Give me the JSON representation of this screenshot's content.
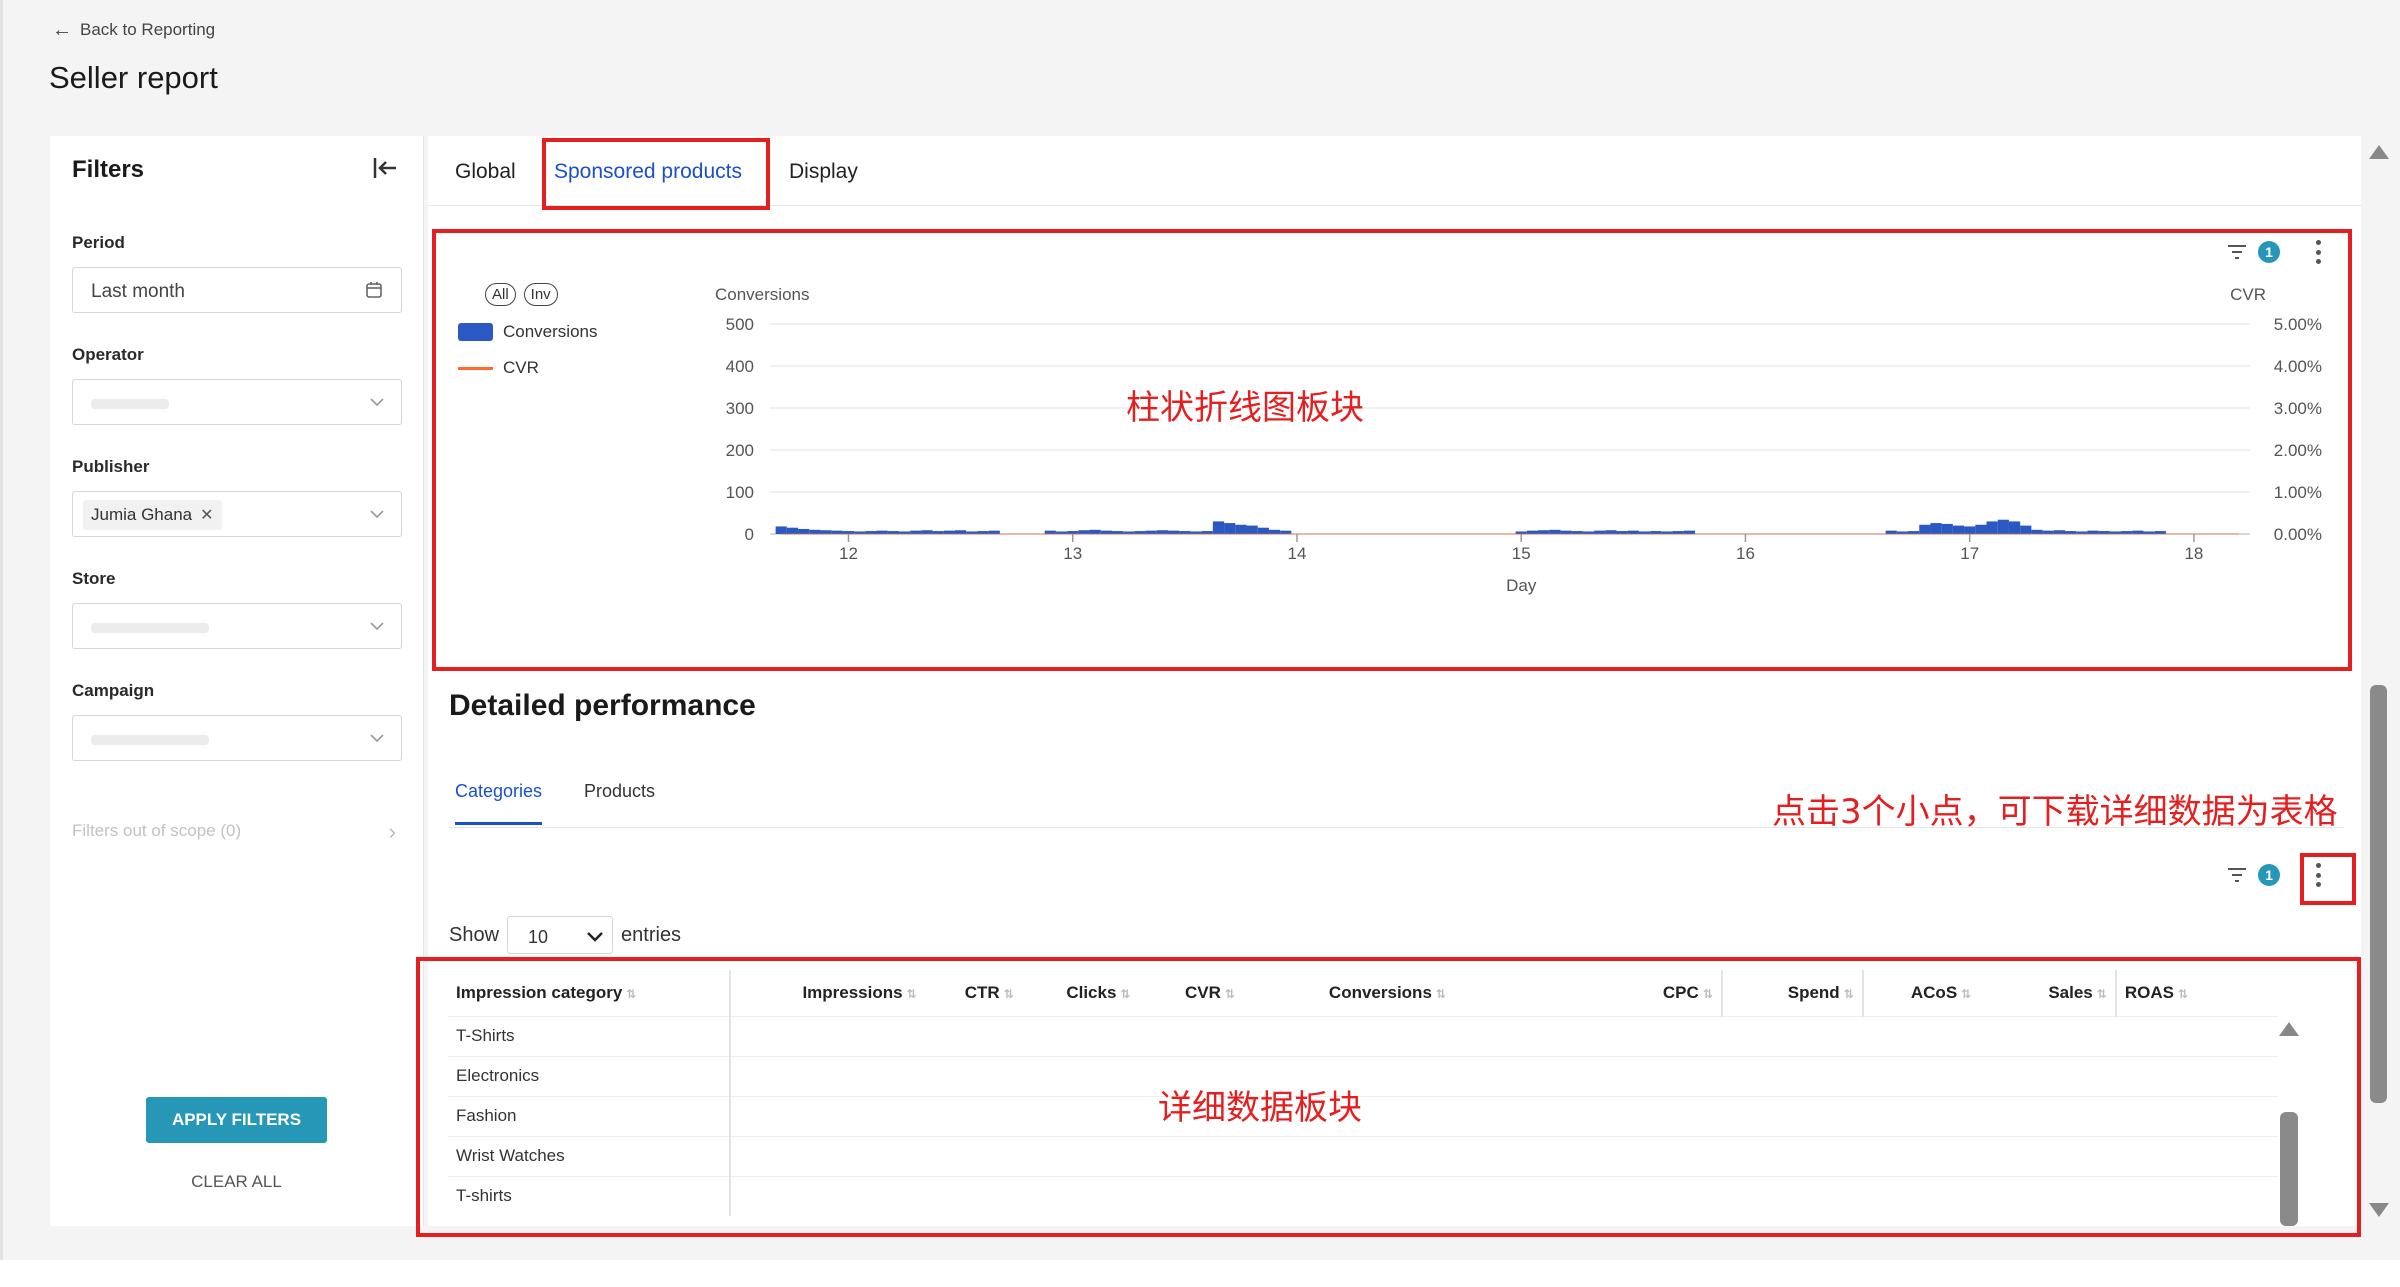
{
  "header": {
    "back_label": "Back to Reporting",
    "page_title": "Seller report"
  },
  "filters": {
    "title": "Filters",
    "period": {
      "label": "Period",
      "value": "Last month"
    },
    "operator": {
      "label": "Operator"
    },
    "publisher": {
      "label": "Publisher",
      "chip": "Jumia Ghana"
    },
    "store": {
      "label": "Store"
    },
    "campaign": {
      "label": "Campaign"
    },
    "out_of_scope": "Filters out of scope (0)",
    "apply_label": "APPLY FILTERS",
    "clear_label": "CLEAR ALL"
  },
  "main_tabs": [
    {
      "label": "Global"
    },
    {
      "label": "Sponsored products"
    },
    {
      "label": "Display"
    }
  ],
  "toolbar": {
    "filter_count": "1"
  },
  "chart_legend": {
    "pill_all": "All",
    "pill_inv": "Inv"
  },
  "chart_data": {
    "type": "bar",
    "title": "",
    "xlabel": "Day",
    "ylabel": "Conversions",
    "y2label": "CVR",
    "ylim": [
      0,
      500
    ],
    "y2lim": [
      0,
      5
    ],
    "yticks": [
      "500",
      "400",
      "300",
      "200",
      "100",
      "0"
    ],
    "y2ticks": [
      "5.00%",
      "4.00%",
      "3.00%",
      "2.00%",
      "1.00%",
      "0.00%"
    ],
    "xticks": [
      12,
      13,
      14,
      15,
      16,
      17,
      18
    ],
    "xlim": [
      11.65,
      18.25
    ],
    "legend": "left",
    "grid": true,
    "series": [
      {
        "name": "Conversions",
        "kind": "bar",
        "color": "#2b59c3",
        "x": [
          11.7,
          11.75,
          11.8,
          11.85,
          11.9,
          11.95,
          12.0,
          12.05,
          12.1,
          12.15,
          12.2,
          12.25,
          12.3,
          12.35,
          12.4,
          12.45,
          12.5,
          12.55,
          12.6,
          12.65,
          12.9,
          12.95,
          13.0,
          13.05,
          13.1,
          13.15,
          13.2,
          13.25,
          13.3,
          13.35,
          13.4,
          13.45,
          13.5,
          13.55,
          13.6,
          13.65,
          13.7,
          13.75,
          13.8,
          13.85,
          13.9,
          13.95,
          15.0,
          15.05,
          15.1,
          15.15,
          15.2,
          15.25,
          15.3,
          15.35,
          15.4,
          15.45,
          15.5,
          15.55,
          15.6,
          15.65,
          15.7,
          15.75,
          16.65,
          16.7,
          16.75,
          16.8,
          16.85,
          16.9,
          16.95,
          17.0,
          17.05,
          17.1,
          17.15,
          17.2,
          17.25,
          17.3,
          17.35,
          17.4,
          17.45,
          17.5,
          17.55,
          17.6,
          17.65,
          17.7,
          17.75,
          17.8,
          17.85
        ],
        "values": [
          18,
          15,
          12,
          10,
          9,
          8,
          7,
          6,
          7,
          8,
          7,
          6,
          8,
          9,
          7,
          8,
          9,
          6,
          7,
          8,
          8,
          6,
          7,
          9,
          10,
          8,
          7,
          6,
          7,
          8,
          9,
          8,
          7,
          6,
          7,
          30,
          26,
          22,
          20,
          15,
          10,
          8,
          6,
          8,
          9,
          10,
          8,
          7,
          6,
          8,
          9,
          7,
          8,
          6,
          7,
          6,
          7,
          8,
          8,
          6,
          7,
          22,
          26,
          24,
          20,
          18,
          22,
          30,
          34,
          30,
          20,
          10,
          8,
          9,
          7,
          6,
          8,
          7,
          6,
          7,
          8,
          6,
          7
        ]
      },
      {
        "name": "CVR",
        "kind": "line",
        "color": "#ff6b2c",
        "axis": "right",
        "x": [
          11.7,
          18.2
        ],
        "values": [
          0,
          0
        ]
      }
    ]
  },
  "detail": {
    "title": "Detailed performance",
    "tabs": [
      {
        "label": "Categories"
      },
      {
        "label": "Products"
      }
    ],
    "show_label": "Show",
    "show_value": "10",
    "entries_label": "entries",
    "columns": [
      "Impression category",
      "Impressions",
      "CTR",
      "Clicks",
      "CVR",
      "Conversions",
      "CPC",
      "Spend",
      "ACoS",
      "Sales",
      "ROAS"
    ],
    "rows": [
      "T-Shirts",
      "Electronics",
      "Fashion",
      "Wrist Watches",
      "T-shirts"
    ]
  },
  "annotations": {
    "chart_block": "柱状折线图板块",
    "download_hint": "点击3个小点，可下载详细数据为表格",
    "table_block": "详细数据板块"
  },
  "colors": {
    "accent": "#1a4fcf",
    "button": "#2797b8",
    "bar": "#2b59c3",
    "line": "#ff6b2c",
    "annotation": "#e51f1f"
  }
}
